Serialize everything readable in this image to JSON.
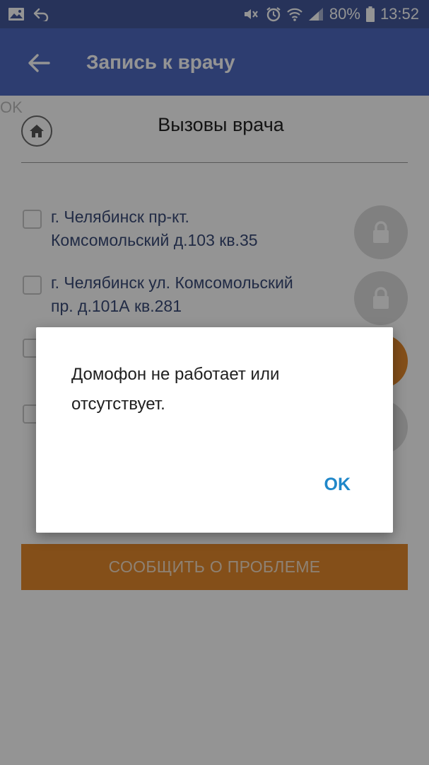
{
  "status_bar": {
    "battery": "80%",
    "time": "13:52",
    "icons": [
      "gallery-icon",
      "return-arrow-icon",
      "mute-icon",
      "alarm-icon",
      "wifi-icon",
      "signal-icon",
      "battery-icon"
    ]
  },
  "app_bar": {
    "title": "Запись к врачу",
    "back_icon": "back-arrow-icon"
  },
  "content": {
    "stray_ok": "OK",
    "home_icon": "home-icon",
    "section_title": "Вызовы врача",
    "addresses": [
      {
        "line1": "г. Челябинск пр-кт.",
        "line2": "Комсомольский д.103 кв.35",
        "button": "gray",
        "icon": "lock-icon"
      },
      {
        "line1": "г. Челябинск ул. Комсомольский",
        "line2": "пр. д.101А кв.281",
        "button": "gray",
        "icon": "lock-icon"
      },
      {
        "line1": "",
        "line2": "",
        "button": "orange",
        "icon": ""
      },
      {
        "line1": "",
        "line2": "",
        "button": "gray",
        "icon": ""
      }
    ],
    "report_button": "СООБЩИТЬ О ПРОБЛЕМЕ"
  },
  "dialog": {
    "message": "Домофон не работает или отсутствует.",
    "ok_label": "OK"
  },
  "colors": {
    "status_bar": "#44599c",
    "app_bar": "#4e69c1",
    "lock_gray": "#dcdcdc",
    "orange": "#e3892b",
    "dialog_button": "#1f87c9"
  }
}
